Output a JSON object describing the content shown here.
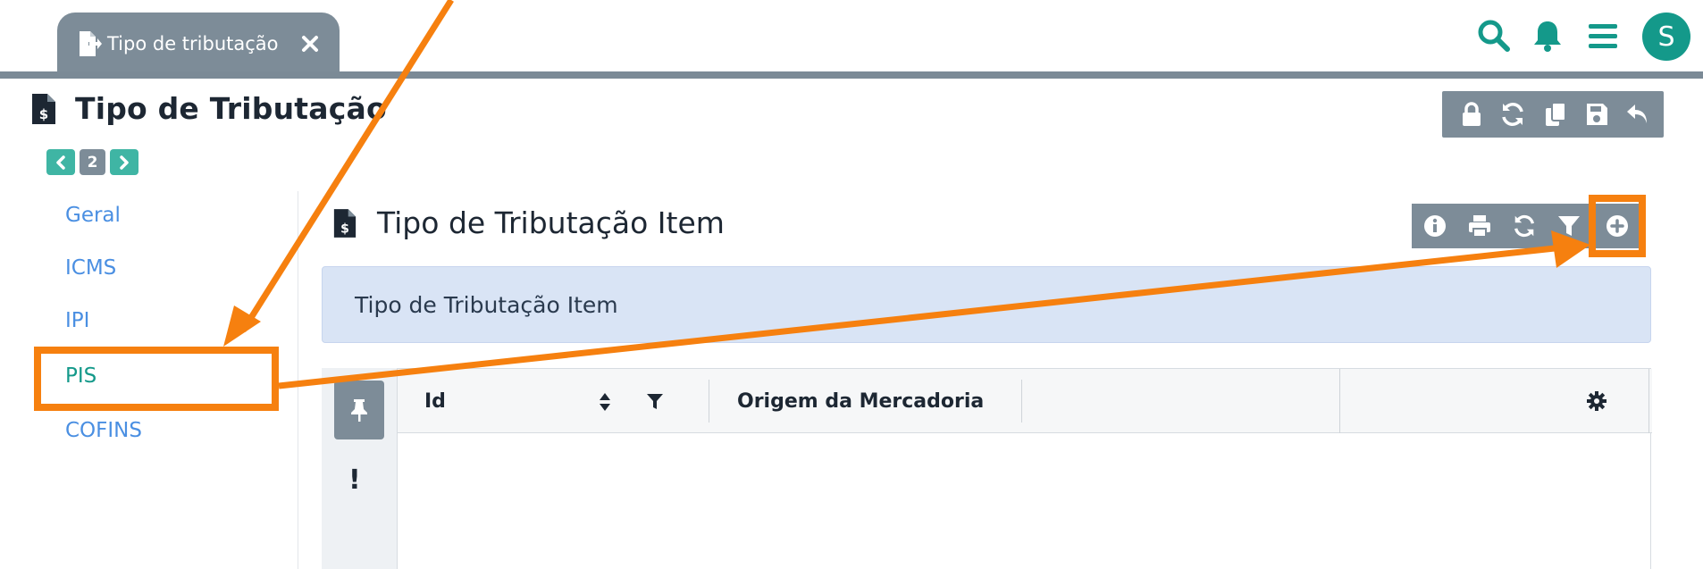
{
  "tabs": [
    {
      "label": "Tipo de tributação",
      "active": true
    }
  ],
  "header": {
    "avatar_letter": "S"
  },
  "page": {
    "title": "Tipo de Tributação"
  },
  "pager": {
    "current": "2"
  },
  "sidebar": {
    "items": [
      {
        "label": "Geral",
        "active": false
      },
      {
        "label": "ICMS",
        "active": false
      },
      {
        "label": "IPI",
        "active": false
      },
      {
        "label": "PIS",
        "active": true
      },
      {
        "label": "COFINS",
        "active": false
      }
    ]
  },
  "section": {
    "title": "Tipo de Tributação Item",
    "info_text": "Tipo de Tributação Item"
  },
  "grid": {
    "columns": [
      {
        "label": "Id"
      },
      {
        "label": "Origem da Mercadoria"
      }
    ]
  },
  "colors": {
    "accent": "#14998a",
    "toolbar": "#7d8c98",
    "link": "#4a8fe2",
    "highlight": "#f6800f"
  }
}
